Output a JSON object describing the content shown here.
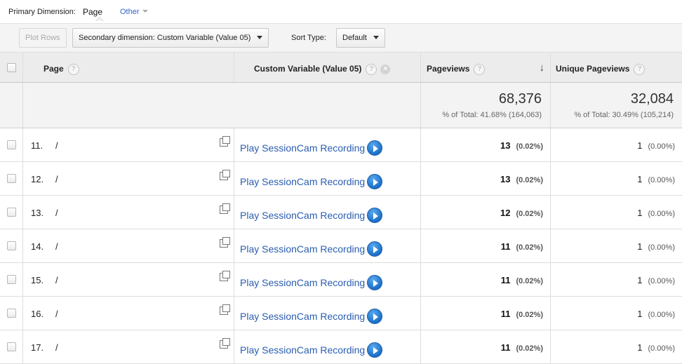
{
  "primary_dimension": {
    "label": "Primary Dimension:",
    "active": "Page",
    "other": "Other"
  },
  "toolbar": {
    "plot_rows": "Plot Rows",
    "secondary_dimension": "Secondary dimension: Custom Variable (Value 05)",
    "sort_type_label": "Sort Type:",
    "sort_type_value": "Default"
  },
  "table": {
    "headers": {
      "page": "Page",
      "custom_variable": "Custom Variable (Value 05)",
      "pageviews": "Pageviews",
      "unique_pageviews": "Unique Pageviews"
    },
    "totals": {
      "pageviews": "68,376",
      "pageviews_pct": "% of Total: 41.68% (164,063)",
      "unique_pageviews": "32,084",
      "unique_pageviews_pct": "% of Total: 30.49% (105,214)"
    },
    "rows": [
      {
        "num": "11.",
        "page": "/",
        "custom": "Play SessionCam Recording",
        "pageviews": "13",
        "pageviews_pct": "(0.02%)",
        "unique": "1",
        "unique_pct": "(0.00%)"
      },
      {
        "num": "12.",
        "page": "/",
        "custom": "Play SessionCam Recording",
        "pageviews": "13",
        "pageviews_pct": "(0.02%)",
        "unique": "1",
        "unique_pct": "(0.00%)"
      },
      {
        "num": "13.",
        "page": "/",
        "custom": "Play SessionCam Recording",
        "pageviews": "12",
        "pageviews_pct": "(0.02%)",
        "unique": "1",
        "unique_pct": "(0.00%)"
      },
      {
        "num": "14.",
        "page": "/",
        "custom": "Play SessionCam Recording",
        "pageviews": "11",
        "pageviews_pct": "(0.02%)",
        "unique": "1",
        "unique_pct": "(0.00%)"
      },
      {
        "num": "15.",
        "page": "/",
        "custom": "Play SessionCam Recording",
        "pageviews": "11",
        "pageviews_pct": "(0.02%)",
        "unique": "1",
        "unique_pct": "(0.00%)"
      },
      {
        "num": "16.",
        "page": "/",
        "custom": "Play SessionCam Recording",
        "pageviews": "11",
        "pageviews_pct": "(0.02%)",
        "unique": "1",
        "unique_pct": "(0.00%)"
      },
      {
        "num": "17.",
        "page": "/",
        "custom": "Play SessionCam Recording",
        "pageviews": "11",
        "pageviews_pct": "(0.02%)",
        "unique": "1",
        "unique_pct": "(0.00%)"
      }
    ]
  },
  "icons": {
    "help": "question-mark-icon",
    "remove": "close-icon",
    "sort": "arrow-down-icon",
    "open_link": "external-link-icon",
    "play": "play-icon"
  }
}
